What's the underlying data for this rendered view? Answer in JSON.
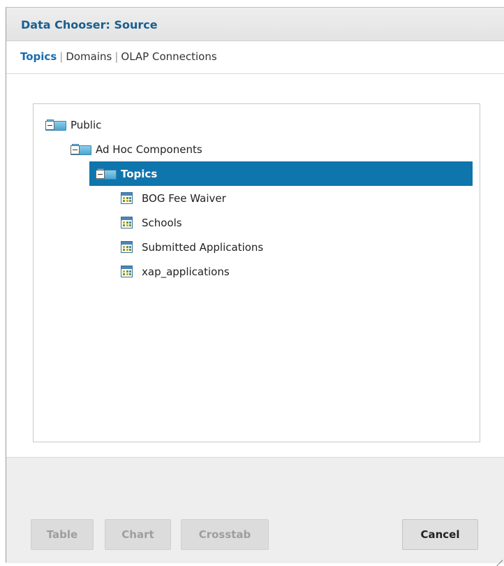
{
  "dialog": {
    "title": "Data Chooser: Source"
  },
  "tabs": [
    {
      "label": "Topics",
      "active": true
    },
    {
      "label": "Domains",
      "active": false
    },
    {
      "label": "OLAP Connections",
      "active": false
    }
  ],
  "tree": {
    "public": "Public",
    "ad_hoc": "Ad Hoc Components",
    "topics": "Topics",
    "items": [
      "BOG Fee Waiver",
      "Schools",
      "Submitted Applications",
      "xap_applications"
    ]
  },
  "buttons": {
    "table": "Table",
    "chart": "Chart",
    "crosstab": "Crosstab",
    "cancel": "Cancel"
  },
  "colors": {
    "accent": "#1a6db0",
    "selection": "#0f75ad"
  },
  "icons": {
    "folder": "folder-open-icon",
    "table": "table-icon",
    "resize": "resize-grip-icon"
  }
}
